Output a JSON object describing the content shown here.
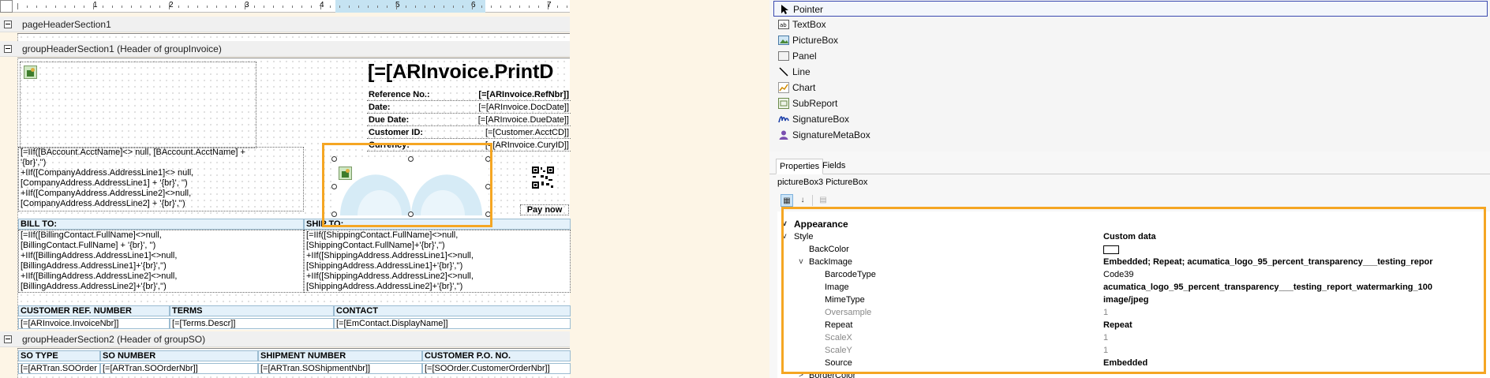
{
  "ruler": {
    "labels": [
      "1",
      "2",
      "3",
      "4",
      "5",
      "6",
      "7"
    ]
  },
  "sections": {
    "page_header": "pageHeaderSection1",
    "group_header_invoice": "groupHeaderSection1 (Header of groupInvoice)",
    "group_header_so": "groupHeaderSection2 (Header of groupSO)"
  },
  "invoice_header": {
    "title_field": "[=[ARInvoice.PrintD",
    "rows": [
      {
        "label": "Reference No.:",
        "value": "[=[ARInvoice.RefNbr]]"
      },
      {
        "label": "Date:",
        "value": "[=[ARInvoice.DocDate]]"
      },
      {
        "label": "Due Date:",
        "value": "[=[ARInvoice.DueDate]]"
      },
      {
        "label": "Customer ID:",
        "value": "[=[Customer.AcctCD]]"
      },
      {
        "label": "Currency:",
        "value": "[=[ARInvoice.CuryID]]"
      }
    ],
    "pay_now": "Pay now"
  },
  "company_address_lines": [
    "[=IIf([BAccount.AcctName]<> null, [BAccount.AcctName] +",
    "'{br}','')",
    "+IIf([CompanyAddress.AddressLine1]<> null,",
    "[CompanyAddress.AddressLine1] + '{br}', '')",
    "+IIf([CompanyAddress.AddressLine2]<>null,",
    "[CompanyAddress.AddressLine2] + '{br}','')"
  ],
  "bill_to": {
    "header": "BILL TO:",
    "lines": [
      "[=IIf([BillingContact.FullName]<>null,",
      "[BillingContact.FullName] + '{br}', '')",
      "+IIf([BillingAddress.AddressLine1]<>null,",
      "[BillingAddress.AddressLine1]+'{br}','')",
      "+IIf([BillingAddress.AddressLine2]<>null,",
      "[BillingAddress.AddressLine2]+'{br}','')"
    ]
  },
  "ship_to": {
    "header": "SHIP TO:",
    "lines": [
      "[=IIf([ShippingContact.FullName]<>null,",
      "[ShippingContact.FullName]+'{br}','')",
      "+IIf([ShippingAddress.AddressLine1]<>null,",
      "[ShippingAddress.AddressLine1]+'{br}','')",
      "+IIf([ShippingAddress.AddressLine2]<>null,",
      "[ShippingAddress.AddressLine2]+'{br}','')"
    ]
  },
  "ref_table": {
    "headers": [
      "CUSTOMER REF. NUMBER",
      "TERMS",
      "CONTACT"
    ],
    "values": [
      "[=[ARInvoice.InvoiceNbr]]",
      "[=[Terms.Descr]]",
      "[=[EmContact.DisplayName]]"
    ]
  },
  "so_table": {
    "headers": [
      "SO TYPE",
      "SO NUMBER",
      "SHIPMENT NUMBER",
      "CUSTOMER P.O. NO."
    ],
    "values": [
      "[=[ARTran.SOOrder",
      "[=[ARTran.SOOrderNbr]]",
      "[=[ARTran.SOShipmentNbr]]",
      "[=[SOOrder.CustomerOrderNbr]]"
    ]
  },
  "toolbox": [
    {
      "label": "Pointer",
      "icon": "pointer-icon",
      "selected": true
    },
    {
      "label": "TextBox",
      "icon": "textbox-icon"
    },
    {
      "label": "PictureBox",
      "icon": "picturebox-icon"
    },
    {
      "label": "Panel",
      "icon": "panel-icon"
    },
    {
      "label": "Line",
      "icon": "line-icon"
    },
    {
      "label": "Chart",
      "icon": "chart-icon"
    },
    {
      "label": "SubReport",
      "icon": "subreport-icon"
    },
    {
      "label": "SignatureBox",
      "icon": "signaturebox-icon"
    },
    {
      "label": "SignatureMetaBox",
      "icon": "signaturemetabox-icon"
    }
  ],
  "tabs": [
    "Properties",
    "Fields"
  ],
  "selected_object": "pictureBox3 PictureBox",
  "properties": {
    "category": "Appearance",
    "rows": [
      {
        "name": "Style",
        "value": "Custom data",
        "level": 1,
        "expander": "v",
        "bold_value": true
      },
      {
        "name": "BackColor",
        "value": "",
        "level": 2,
        "swatch": true
      },
      {
        "name": "BackImage",
        "value": "Embedded; Repeat; acumatica_logo_95_percent_transparency___testing_repor",
        "level": 2,
        "expander": "v",
        "bold_value": true
      },
      {
        "name": "BarcodeType",
        "value": "Code39",
        "level": 3
      },
      {
        "name": "Image",
        "value": "acumatica_logo_95_percent_transparency___testing_report_watermarking_100",
        "level": 3,
        "bold_value": true
      },
      {
        "name": "MimeType",
        "value": "image/jpeg",
        "level": 3,
        "bold_value": true
      },
      {
        "name": "Oversample",
        "value": "1",
        "level": 3,
        "dim": true
      },
      {
        "name": "Repeat",
        "value": "Repeat",
        "level": 3,
        "bold_value": true
      },
      {
        "name": "ScaleX",
        "value": "1",
        "level": 3,
        "dim": true
      },
      {
        "name": "ScaleY",
        "value": "1",
        "level": 3,
        "dim": true
      },
      {
        "name": "Source",
        "value": "Embedded",
        "level": 3,
        "bold_value": true
      },
      {
        "name": "BorderColor",
        "value": "",
        "level": 2,
        "expander": ">"
      }
    ]
  },
  "colors": {
    "highlight": "#f5a623",
    "header_fill": "#e4f1fa",
    "selected_tool_border": "#3a4ab0"
  }
}
